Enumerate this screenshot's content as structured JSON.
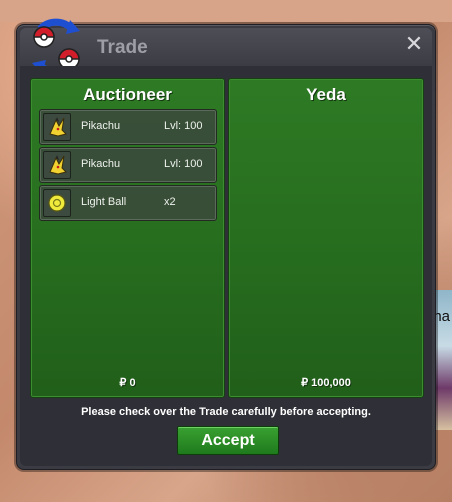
{
  "window": {
    "title": "Trade"
  },
  "left_panel": {
    "title": "Auctioneer",
    "items": [
      {
        "name": "Pikachu",
        "qty": "Lvl: 100",
        "icon": "pikachu-icon"
      },
      {
        "name": "Pikachu",
        "qty": "Lvl: 100",
        "icon": "pikachu-icon"
      },
      {
        "name": "Light Ball",
        "qty": "x2",
        "icon": "light-ball-icon"
      }
    ],
    "money": "₽ 0"
  },
  "right_panel": {
    "title": "Yeda",
    "money": "₽ 100,000"
  },
  "notice": "Please check over the Trade carefully before accepting.",
  "accept_label": "Accept",
  "background": {
    "partial_text": "na"
  },
  "colors": {
    "panel_green": "#276e1f",
    "window_bg": "#3b3b43",
    "accept_green": "#2a8c26"
  }
}
